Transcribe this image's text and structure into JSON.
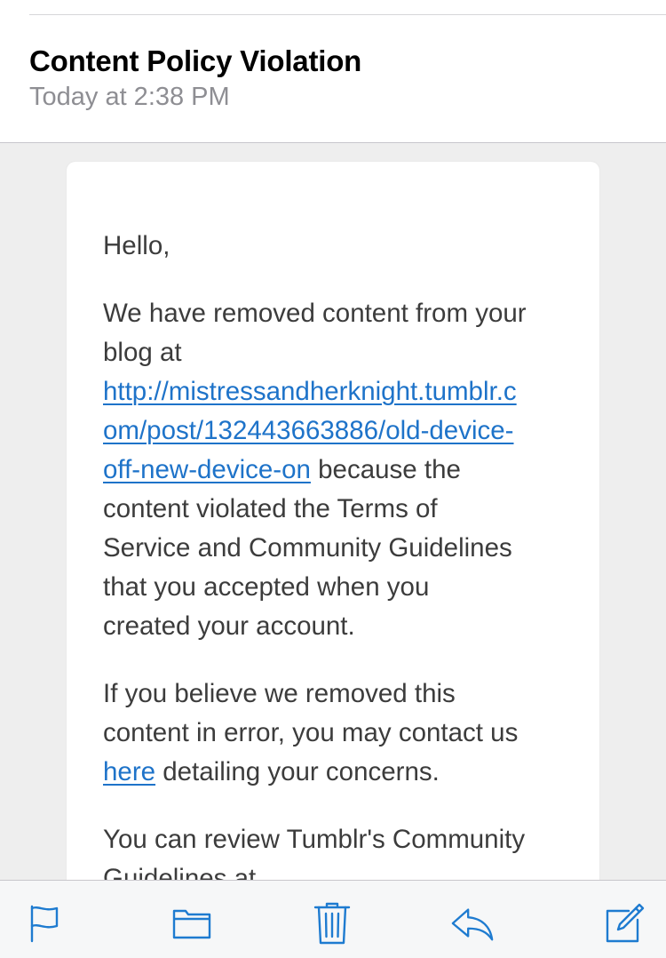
{
  "header": {
    "subject": "Content Policy Violation",
    "date": "Today at 2:38 PM"
  },
  "message": {
    "greeting": "Hello,",
    "p1_line1": "We have removed content from your",
    "p1_line2": "blog at",
    "p1_link_line1": "http://mistressandherknight.tumblr.c",
    "p1_link_line2": "om/post/132443663886/old-device-",
    "p1_link_line3": "off-new-device-on",
    "p1_after_link": " because the",
    "p1_line6": "content violated the Terms of",
    "p1_line7": "Service and Community Guidelines",
    "p1_line8": "that you accepted when you",
    "p1_line9": "created your account.",
    "p2_line1": "If you believe we removed this",
    "p2_line2": "content in error, you may contact us",
    "p2_link": "here",
    "p2_after_link": " detailing your concerns.",
    "p3_line1": "You can review Tumblr's Community",
    "p3_line2": "Guidelines at"
  },
  "toolbar": {
    "icons": [
      "flag-icon",
      "folder-icon",
      "trash-icon",
      "reply-icon",
      "compose-icon"
    ],
    "tint": "#1e7bd0"
  }
}
